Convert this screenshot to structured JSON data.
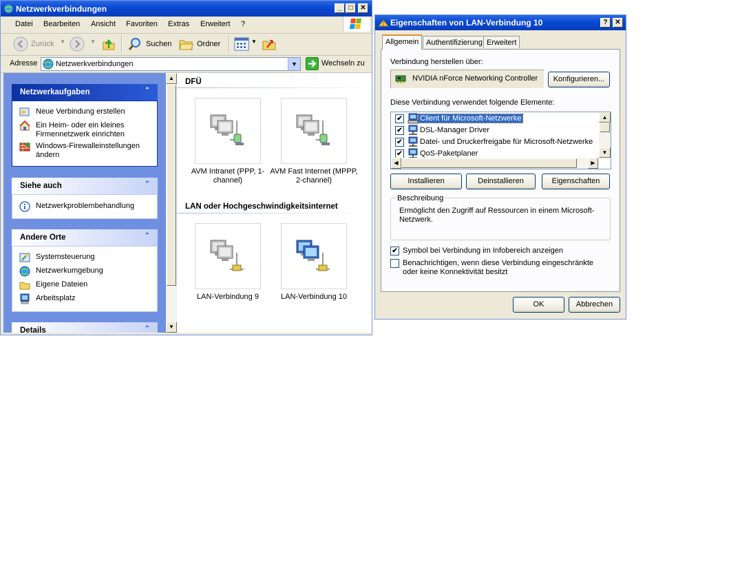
{
  "explorer": {
    "title": "Netzwerkverbindungen",
    "window_buttons": {
      "minimize": "_",
      "maximize": "□",
      "close": "✕"
    },
    "menu": [
      "Datei",
      "Bearbeiten",
      "Ansicht",
      "Favoriten",
      "Extras",
      "Erweitert",
      "?"
    ],
    "toolbar": {
      "back": "Zurück",
      "search": "Suchen",
      "folders": "Ordner"
    },
    "address": {
      "label": "Adresse",
      "value": "Netzwerkverbindungen",
      "go": "Wechseln zu"
    },
    "tasks_panel": {
      "title": "Netzwerkaufgaben",
      "items": [
        "Neue Verbindung erstellen",
        "Ein Heim- oder ein kleines Firmennetzwerk einrichten",
        "Windows-Firewalleinstellungen ändern"
      ]
    },
    "see_also_panel": {
      "title": "Siehe auch",
      "items": [
        "Netzwerkproblembehandlung"
      ]
    },
    "other_places_panel": {
      "title": "Andere Orte",
      "items": [
        "Systemsteuerung",
        "Netzwerkumgebung",
        "Eigene Dateien",
        "Arbeitsplatz"
      ]
    },
    "details_panel": {
      "title": "Details"
    },
    "groups": [
      {
        "title": "DFÜ",
        "items": [
          "AVM Intranet (PPP, 1-channel)",
          "AVM Fast Internet (MPPP, 2-channel)"
        ]
      },
      {
        "title": "LAN oder Hochgeschwindigkeitsinternet",
        "items": [
          "LAN-Verbindung 9",
          "LAN-Verbindung 10"
        ]
      }
    ]
  },
  "dialog": {
    "title": "Eigenschaften von LAN-Verbindung 10",
    "title_buttons": {
      "help": "?",
      "close": "✕"
    },
    "tabs": [
      "Allgemein",
      "Authentifizierung",
      "Erweitert"
    ],
    "connect_using_label": "Verbindung herstellen über:",
    "adapter": "NVIDIA nForce Networking Controller",
    "configure_button": "Konfigurieren...",
    "components_label": "Diese Verbindung verwendet folgende Elemente:",
    "components": [
      {
        "label": "Client für Microsoft-Netzwerke",
        "checked": true
      },
      {
        "label": "DSL-Manager Driver",
        "checked": true
      },
      {
        "label": "Datei- und Druckerfreigabe für Microsoft-Netzwerke",
        "checked": true
      },
      {
        "label": "QoS-Paketplaner",
        "checked": true
      }
    ],
    "buttons": {
      "install": "Installieren",
      "uninstall": "Deinstallieren",
      "properties": "Eigenschaften",
      "ok": "OK",
      "cancel": "Abbrechen"
    },
    "description": {
      "title": "Beschreibung",
      "text": "Ermöglicht den Zugriff auf Ressourcen in einem Microsoft-Netzwerk."
    },
    "show_icon_label": "Symbol bei Verbindung im Infobereich anzeigen",
    "show_icon_checked": true,
    "notify_label": "Benachrichtigen, wenn diese Verbindung eingeschränkte oder keine Konnektivität besitzt",
    "notify_checked": false,
    "check_mark": "✔"
  }
}
